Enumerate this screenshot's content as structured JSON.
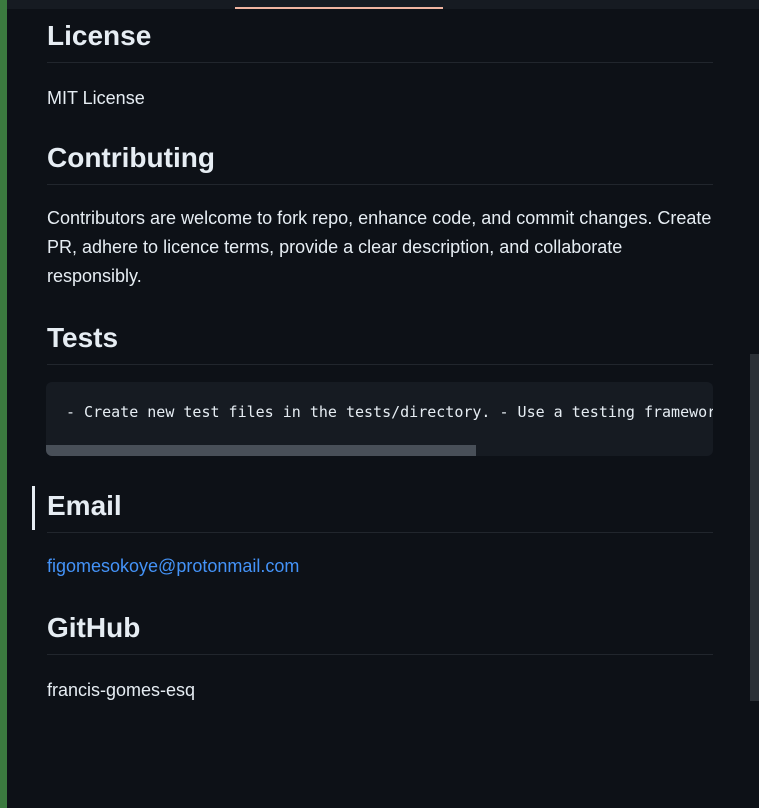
{
  "sections": {
    "license": {
      "heading": "License",
      "body": "MIT License"
    },
    "contributing": {
      "heading": "Contributing",
      "body": "Contributors are welcome to fork repo, enhance code, and commit changes. Create PR, adhere to licence terms, provide a clear description, and collaborate responsibly."
    },
    "tests": {
      "heading": "Tests",
      "code": "- Create new test files in the tests/directory. - Use a testing framewor"
    },
    "email": {
      "heading": "Email",
      "address": "figomesokoye@protonmail.com"
    },
    "github": {
      "heading": "GitHub",
      "username": "francis-gomes-esq"
    }
  },
  "colors": {
    "background": "#0d1117",
    "text": "#e6edf3",
    "link": "#4493f8",
    "code_background": "#161b22",
    "left_strip": "#3b7a3f",
    "tab_underline": "#f0b4a0"
  }
}
